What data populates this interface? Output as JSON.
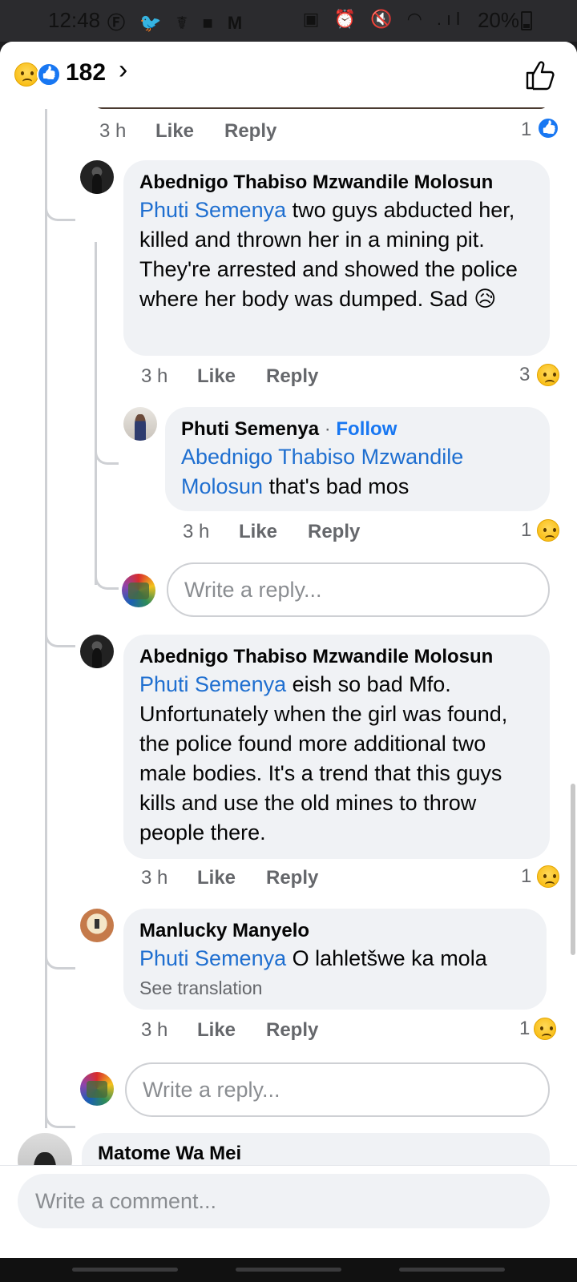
{
  "status_bar": {
    "time": "12:48",
    "left_icons": "Ⓕ 🐦 ☤ ■ M",
    "right_icons": "▣ ⏰ 🔇 ◠ .ıl",
    "battery": "20%"
  },
  "header": {
    "reaction_icons": [
      "sad-emoji-icon",
      "like-icon"
    ],
    "count": "182",
    "chevron": "›",
    "like_button_icon": "thumbs-up-outline-icon"
  },
  "top_meta": {
    "time": "3 h",
    "like": "Like",
    "reply": "Reply",
    "reaction_count": "1",
    "reaction": "like-icon"
  },
  "comments": [
    {
      "author": "Abednigo Thabiso Mzwandile Molosun",
      "mention": "Phuti Semenya",
      "text": " two guys abducted her, killed and thrown her in a mining pit. They're arrested and showed the police where her body was dumped. Sad 😥",
      "time": "3 h",
      "like": "Like",
      "reply": "Reply",
      "reaction_count": "3",
      "reaction": "sad-emoji-icon"
    },
    {
      "author": "Phuti Semenya",
      "separator": " · ",
      "follow": "Follow",
      "mention": "Abednigo Thabiso Mzwandile Molosun",
      "text": " that's bad mos",
      "time": "3 h",
      "like": "Like",
      "reply": "Reply",
      "reaction_count": "1",
      "reaction": "sad-emoji-icon"
    },
    {
      "author": "Abednigo Thabiso Mzwandile Molosun",
      "mention": "Phuti Semenya",
      "text": " eish so bad Mfo. Unfortunately when the girl was found, the police found more additional two male bodies. It's a trend that this guys kills and use the old mines to throw people there.",
      "time": "3 h",
      "like": "Like",
      "reply": "Reply",
      "reaction_count": "1",
      "reaction": "sad-emoji-icon"
    },
    {
      "author": "Manlucky Manyelo",
      "mention": "Phuti Semenya",
      "text": "  O lahletšwe ka mola",
      "see_translation": "See translation",
      "time": "3 h",
      "like": "Like",
      "reply": "Reply",
      "reaction_count": "1",
      "reaction": "sad-emoji-icon"
    }
  ],
  "reply_placeholder": "Write a reply...",
  "next_author": "Matome Wa Mei",
  "comment_placeholder": "Write a comment..."
}
